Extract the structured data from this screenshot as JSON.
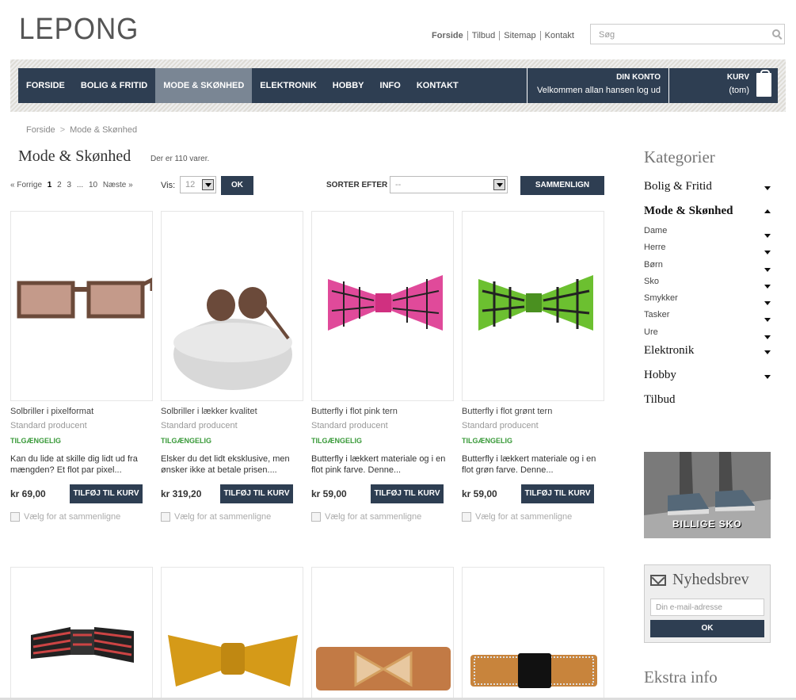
{
  "header": {
    "logo": "LEPONG",
    "toplinks": [
      "Forside",
      "Tilbud",
      "Sitemap",
      "Kontakt"
    ],
    "search_placeholder": "Søg"
  },
  "nav": {
    "items": [
      "FORSIDE",
      "BOLIG & FRITID",
      "MODE & SKØNHED",
      "ELEKTRONIK",
      "HOBBY",
      "INFO",
      "KONTAKT"
    ],
    "active_index": 2,
    "account_title": "DIN KONTO",
    "account_text": "Velkommen allan hansen log ud",
    "cart_title": "KURV",
    "cart_text": "(tom)"
  },
  "breadcrumb": [
    "Forside",
    "Mode & Skønhed"
  ],
  "page": {
    "title": "Mode & Skønhed",
    "count": "Der er 110 varer.",
    "pager": {
      "prev": "« Forrige",
      "pages": [
        "1",
        "2",
        "3",
        "...",
        "10"
      ],
      "current": "1",
      "next": "Næste »"
    },
    "vis_label": "Vis:",
    "vis_value": "12",
    "ok": "OK",
    "sort_label": "SORTER EFTER",
    "sort_value": "--",
    "compare": "SAMMENLIGN"
  },
  "products": [
    {
      "name": "Solbriller i pixelformat",
      "mfr": "Standard producent",
      "stock": "TILGÆNGELIG",
      "desc": "Kan du lide at skille dig lidt ud fra mængden? Et flot par pixel...",
      "price": "kr 69,00",
      "add": "TILFØJ TIL KURV",
      "compare": "Vælg for at sammenligne",
      "icon": "sunglasses-pixel"
    },
    {
      "name": "Solbriller i lækker kvalitet",
      "mfr": "Standard producent",
      "stock": "TILGÆNGELIG",
      "desc": "Elsker du det lidt eksklusive, men ønsker ikke at betale prisen....",
      "price": "kr 319,20",
      "add": "TILFØJ TIL KURV",
      "compare": "Vælg for at sammenligne",
      "icon": "sunglasses-case"
    },
    {
      "name": "Butterfly i flot pink tern",
      "mfr": "Standard producent",
      "stock": "TILGÆNGELIG",
      "desc": "Butterfly i lækkert materiale og i en flot pink farve. Denne...",
      "price": "kr 59,00",
      "add": "TILFØJ TIL KURV",
      "compare": "Vælg for at sammenligne",
      "icon": "bowtie-pink"
    },
    {
      "name": "Butterfly i flot grønt tern",
      "mfr": "Standard producent",
      "stock": "TILGÆNGELIG",
      "desc": "Butterfly i lækkert materiale og i en flot grøn farve. Denne...",
      "price": "kr 59,00",
      "add": "TILFØJ TIL KURV",
      "compare": "Vælg for at sammenligne",
      "icon": "bowtie-green"
    }
  ],
  "row2_images": [
    "bowtie-striped",
    "bowtie-gold",
    "belt-brown",
    "belt-orange"
  ],
  "sidebar": {
    "title": "Kategorier",
    "categories": [
      {
        "label": "Bolig & Fritid",
        "open": false
      },
      {
        "label": "Mode & Skønhed",
        "open": true,
        "sub": [
          "Dame",
          "Herre",
          "Børn",
          "Sko",
          "Smykker",
          "Tasker",
          "Ure"
        ]
      },
      {
        "label": "Elektronik",
        "open": false
      },
      {
        "label": "Hobby",
        "open": false
      },
      {
        "label": "Tilbud",
        "open": false
      }
    ],
    "banner_text": "BILLIGE SKO",
    "newsletter_title": "Nyhedsbrev",
    "newsletter_placeholder": "Din e-mail-adresse",
    "newsletter_ok": "OK",
    "extra_title": "Ekstra info"
  },
  "colors": {
    "nav": "#2e3e52",
    "active": "#7a8694",
    "stock": "#3a9a3a"
  }
}
